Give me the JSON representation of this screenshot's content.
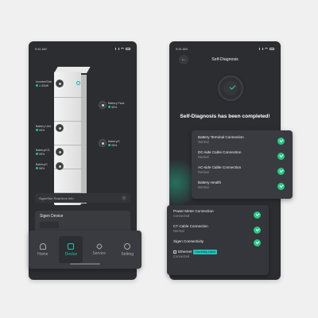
{
  "colors": {
    "accent": "#1ec6a8",
    "success": "#25c985",
    "background": "#f0f0f0",
    "phone": "#2c2d31",
    "badge": "#1fc7c0"
  },
  "left_phone": {
    "status_time": "9:41 AM",
    "battery_tags": [
      {
        "label": "Inverter/Stat",
        "value": "1.32kW"
      },
      {
        "label": "Battery Pack",
        "value": "96%"
      },
      {
        "label": "Battery Unit",
        "value": "95%"
      },
      {
        "label": "Battery/C",
        "value": "95%"
      },
      {
        "label": "Battery/CS",
        "value": "95%"
      },
      {
        "label": "Battery/C",
        "value": "98%"
      }
    ],
    "info_row": "SigenStor Real-time Info",
    "info_arrow": "›",
    "device_card_title": "Sigen Device",
    "tabs": [
      {
        "label": "Home",
        "icon": "home-icon"
      },
      {
        "label": "Device",
        "icon": "device-icon"
      },
      {
        "label": "Service",
        "icon": "service-icon"
      },
      {
        "label": "Setting",
        "icon": "setting-icon"
      }
    ],
    "active_tab": "Device"
  },
  "right_phone": {
    "status_time": "9:41 AM",
    "back_glyph": "←",
    "title": "Self-Diagnosis",
    "completed_text": "Self-Diagnosis has been completed!",
    "panel_ac": [
      {
        "name": "Battery Terminal Connection",
        "status": "Normal"
      },
      {
        "name": "DC-side Cable Connection",
        "status": "Normal"
      },
      {
        "name": "AC-side Cable Connection",
        "status": "Normal"
      },
      {
        "name": "Battery Health",
        "status": "Normal"
      }
    ],
    "panel_dc": [
      {
        "name": "Power Meter Connection",
        "status": "Connected"
      },
      {
        "name": "CT Cable Connection",
        "status": "Normal"
      },
      {
        "name": "Sigen Connectivity",
        "status": ""
      }
    ],
    "ethernet": {
      "name": "Ethernet",
      "badge": "Currently Used",
      "status": "Connected"
    }
  }
}
